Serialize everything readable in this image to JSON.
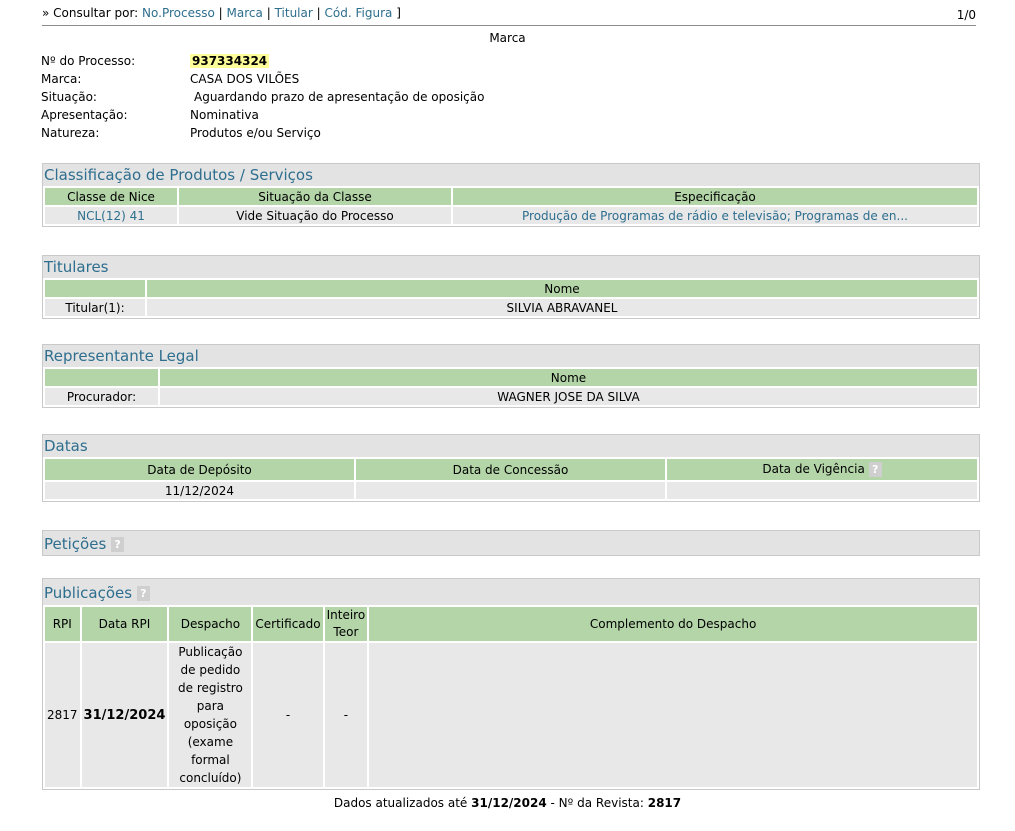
{
  "topbar": {
    "prefix": "» Consultar por:",
    "links": [
      "No.Processo",
      "Marca",
      "Titular",
      "Cód. Figura"
    ],
    "suffix": "]",
    "pagination": "1/0"
  },
  "section_title": "Marca",
  "info": {
    "processo_label": "Nº do Processo:",
    "processo_value": "937334324",
    "marca_label": "Marca:",
    "marca_value": "CASA DOS VILÕES",
    "situacao_label": "Situação:",
    "situacao_value": "Aguardando prazo de apresentação de oposição",
    "apresentacao_label": "Apresentação:",
    "apresentacao_value": "Nominativa",
    "natureza_label": "Natureza:",
    "natureza_value": "Produtos e/ou Serviço"
  },
  "classificacao": {
    "title": "Classificação de Produtos / Serviços",
    "headers": [
      "Classe de Nice",
      "Situação da Classe",
      "Especificação"
    ],
    "row": [
      "NCL(12) 41",
      "Vide Situação do Processo",
      "Produção de Programas de rádio e televisão; Programas de en..."
    ]
  },
  "titulares": {
    "title": "Titulares",
    "header": "Nome",
    "label": "Titular(1):",
    "value": "SILVIA ABRAVANEL"
  },
  "representante": {
    "title": "Representante Legal",
    "header": "Nome",
    "label": "Procurador:",
    "value": "WAGNER JOSE DA SILVA"
  },
  "datas": {
    "title": "Datas",
    "headers": [
      "Data de Depósito",
      "Data de Concessão",
      "Data de Vigência"
    ],
    "values": [
      "11/12/2024",
      "",
      ""
    ]
  },
  "peticoes": {
    "title": "Petições"
  },
  "publicacoes": {
    "title": "Publicações",
    "headers": [
      "RPI",
      "Data RPI",
      "Despacho",
      "Certificado",
      "Inteiro Teor",
      "Complemento do Despacho"
    ],
    "row": {
      "rpi": "2817",
      "data": "31/12/2024",
      "despacho": "Publicação de pedido de registro para oposição (exame formal concluído)",
      "certificado": "-",
      "inteiro_teor": "-",
      "complemento": ""
    }
  },
  "help_icon": "?",
  "footer": {
    "prefix": "Dados atualizados até",
    "date": "31/12/2024",
    "middle": "- Nº da Revista:",
    "revista": "2817"
  }
}
